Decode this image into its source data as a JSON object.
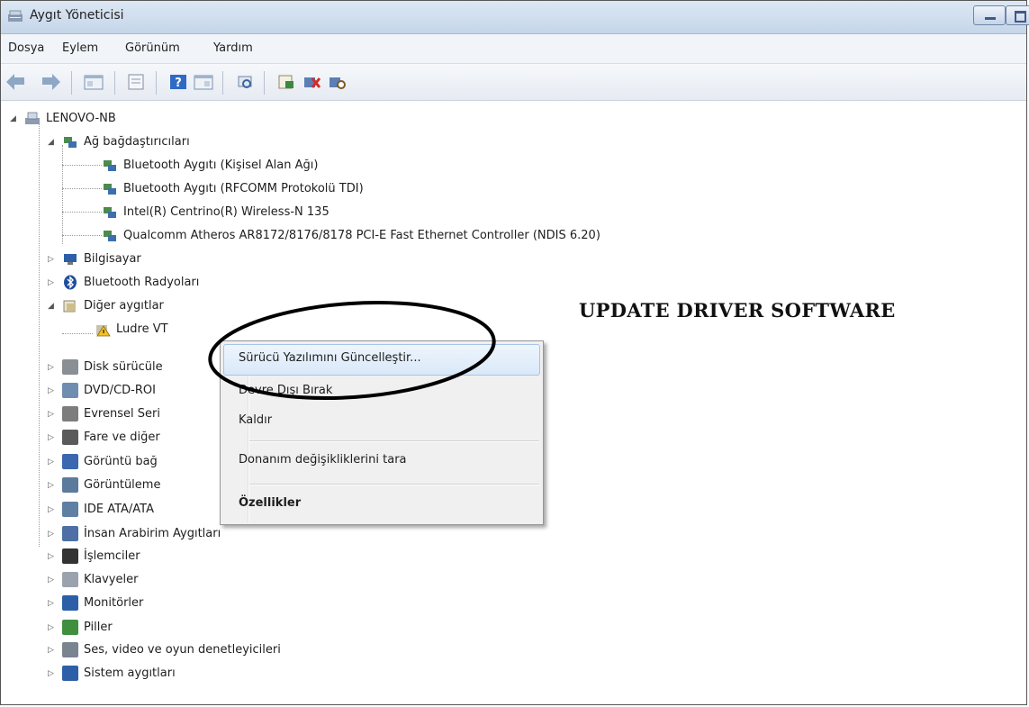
{
  "window": {
    "title": "Aygıt Yöneticisi",
    "icon": "device-manager-icon"
  },
  "menu": [
    "Dosya",
    "Eylem",
    "Görünüm",
    "Yardım"
  ],
  "toolbar_icons": [
    "back-icon",
    "forward-icon",
    "show-hide-console-tree-icon",
    "properties-icon",
    "help-icon",
    "action-pane-icon",
    "scan-hardware-icon",
    "update-driver-icon",
    "uninstall-icon",
    "disable-icon"
  ],
  "tree": {
    "root": "LENOVO-NB",
    "network_category": "Ağ bağdaştırıcıları",
    "network_children": [
      "Bluetooth Aygıtı (Kişisel Alan Ağı)",
      "Bluetooth Aygıtı (RFCOMM Protokolü TDI)",
      "Intel(R) Centrino(R) Wireless-N 135",
      "Qualcomm Atheros AR8172/8176/8178 PCI-E Fast Ethernet Controller (NDIS 6.20)"
    ],
    "computer": "Bilgisayar",
    "bluetooth": "Bluetooth Radyoları",
    "other_devices": "Diğer aygıtlar",
    "other_child": "Ludre VT",
    "after_categories": [
      "Disk sürücüle",
      "DVD/CD-ROI",
      "Evrensel Seri",
      "Fare ve diğer",
      "Görüntü bağ",
      "Görüntüleme",
      "IDE ATA/ATA",
      "İnsan Arabirim Aygıtları",
      "İşlemciler",
      "Klavyeler",
      "Monitörler",
      "Piller",
      "Ses, video ve oyun denetleyicileri",
      "Sistem aygıtları"
    ]
  },
  "context_menu": {
    "items": [
      "Sürücü Yazılımını Güncelleştir...",
      "Devre Dışı Bırak",
      "Kaldır",
      "Donanım değişikliklerini tara",
      "Özellikler"
    ]
  },
  "annotation": "UPDATE DRIVER SOFTWARE",
  "colors": {
    "highlight": "#d9e8f8",
    "annotation_ellipse": "#000000"
  }
}
